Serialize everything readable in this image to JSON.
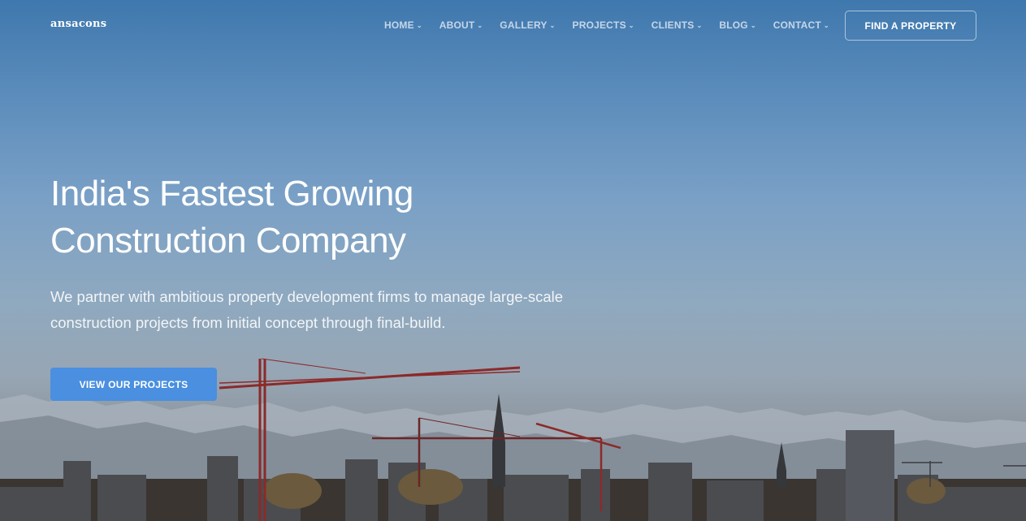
{
  "brand": {
    "logo_text": "ansacons"
  },
  "nav": {
    "items": [
      {
        "label": "HOME"
      },
      {
        "label": "ABOUT"
      },
      {
        "label": "GALLERY"
      },
      {
        "label": "PROJECTS"
      },
      {
        "label": "CLIENTS"
      },
      {
        "label": "BLOG"
      },
      {
        "label": "CONTACT"
      }
    ],
    "chevron": "⌄",
    "cta_label": "FIND A PROPERTY"
  },
  "hero": {
    "headline_line1": "India's Fastest Growing",
    "headline_line2": "Construction Company",
    "subtext_line1": "We partner with ambitious property development firms to manage large-scale",
    "subtext_line2": "construction projects from initial concept through final-build.",
    "button_label": "VIEW OUR PROJECTS"
  },
  "colors": {
    "sky_top": "#3f78ae",
    "accent_button": "#4a8fe0",
    "crane_red": "#8b2a2a"
  }
}
